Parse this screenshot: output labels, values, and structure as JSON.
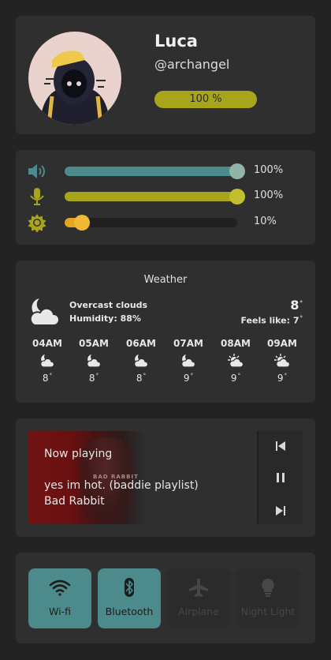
{
  "profile": {
    "name": "Luca",
    "handle": "@archangel",
    "battery": "100 %",
    "battery_fraction": 1.0
  },
  "sliders": [
    {
      "name": "volume",
      "icon": "speaker-icon",
      "value": 1.0,
      "label": "100%",
      "color": "#4c8a8c",
      "knob": "#8fb5a8"
    },
    {
      "name": "microphone",
      "icon": "microphone-icon",
      "value": 1.0,
      "label": "100%",
      "color": "#a7a51c",
      "knob": "#c2bf2c"
    },
    {
      "name": "brightness",
      "icon": "sun-icon",
      "value": 0.1,
      "label": "10%",
      "color": "#e3a524",
      "knob": "#f2b933"
    }
  ],
  "weather": {
    "title": "Weather",
    "condition": "Overcast clouds",
    "humidity": "Humidity: 88%",
    "temp": "8",
    "feels": "Feels like: 7",
    "degree": "°",
    "hourly": [
      {
        "time": "04AM",
        "temp": "8",
        "icon": "cloud-moon-icon"
      },
      {
        "time": "05AM",
        "temp": "8",
        "icon": "cloud-moon-icon"
      },
      {
        "time": "06AM",
        "temp": "8",
        "icon": "cloud-moon-icon"
      },
      {
        "time": "07AM",
        "temp": "9",
        "icon": "cloud-moon-icon"
      },
      {
        "time": "08AM",
        "temp": "9",
        "icon": "cloud-sun-icon"
      },
      {
        "time": "09AM",
        "temp": "9",
        "icon": "cloud-sun-icon"
      }
    ]
  },
  "music": {
    "status": "Now playing",
    "title": "yes im hot. (baddie playlist)",
    "artist": "Bad Rabbit",
    "art_text": "BAD RABBIT"
  },
  "toggles": [
    {
      "label": "Wi-fi",
      "icon": "wifi-icon",
      "active": true
    },
    {
      "label": "Bluetooth",
      "icon": "bluetooth-icon",
      "active": true
    },
    {
      "label": "Airplane",
      "icon": "airplane-icon",
      "active": false
    },
    {
      "label": "Night Light",
      "icon": "lightbulb-icon",
      "active": false
    }
  ],
  "colors": {
    "accent_teal": "#4c8a8c",
    "accent_olive": "#a7a51c",
    "accent_orange": "#e3a524",
    "card": "#2f2f2f",
    "background": "#232323"
  }
}
